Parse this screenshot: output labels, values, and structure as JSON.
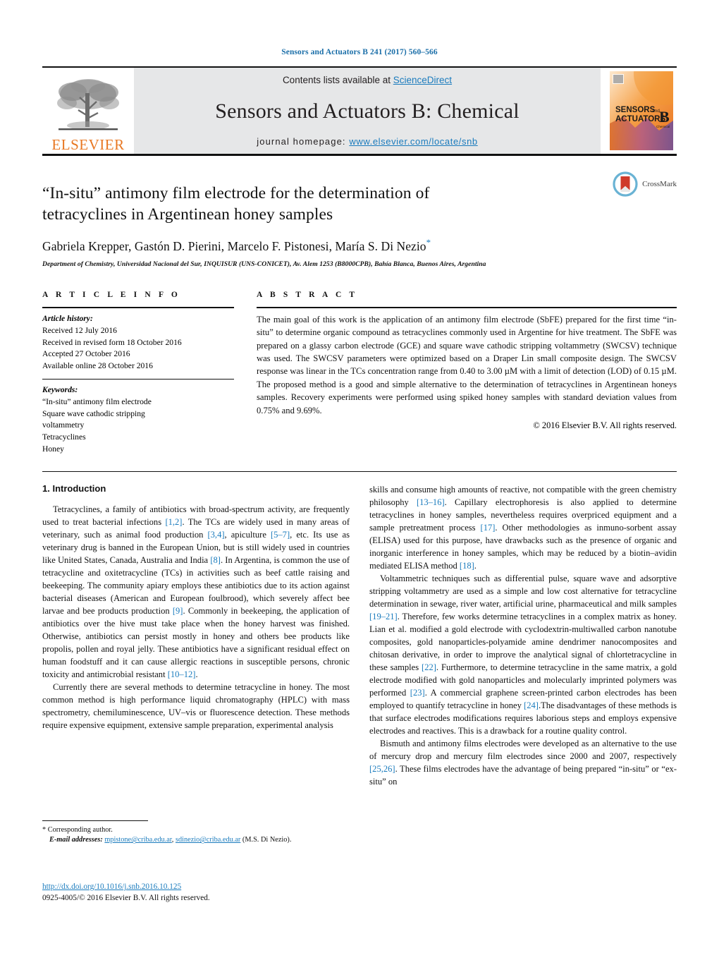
{
  "running_head": "Sensors and Actuators B 241 (2017) 560–566",
  "masthead": {
    "contents_prefix": "Contents lists available at ",
    "sciencedirect": "ScienceDirect",
    "journal_title": "Sensors and Actuators B: Chemical",
    "homepage_prefix": "journal homepage: ",
    "homepage_url": "www.elsevier.com/locate/snb",
    "publisher": "ELSEVIER",
    "cover_line1": "SENSORS",
    "cover_and": "and",
    "cover_line2": "ACTUATORS",
    "cover_letter": "B",
    "cover_sub": "Chemical",
    "accent_orange": "#E87722",
    "accent_blue": "#1a7bbd",
    "band_gray": "#e6e7e8"
  },
  "title_block": {
    "title": "“In-situ” antimony film electrode for the determination of tetracyclines in Argentinean honey samples",
    "authors": "Gabriela Krepper, Gastón D. Pierini, Marcelo F. Pistonesi, María S. Di Nezio",
    "corresponding_marker": "*",
    "affiliation": "Department of Chemistry, Universidad Nacional del Sur, INQUISUR (UNS-CONICET), Av. Alem 1253 (B8000CPB), Bahía Blanca, Buenos Aires, Argentina",
    "crossmark_label": "CrossMark"
  },
  "article_info": {
    "heading": "A R T I C L E   I N F O",
    "history_label": "Article history:",
    "history": [
      "Received 12 July 2016",
      "Received in revised form 18 October 2016",
      "Accepted 27 October 2016",
      "Available online 28 October 2016"
    ],
    "keywords_label": "Keywords:",
    "keywords": [
      "“In-situ” antimony film electrode",
      "Square wave cathodic stripping",
      "voltammetry",
      "Tetracyclines",
      "Honey"
    ]
  },
  "abstract": {
    "heading": "A B S T R A C T",
    "text": "The main goal of this work is the application of an antimony film electrode (SbFE) prepared for the first time “in-situ” to determine organic compound as tetracyclines commonly used in Argentine for hive treatment. The SbFE was prepared on a glassy carbon electrode (GCE) and square wave cathodic stripping voltammetry (SWCSV) technique was used. The SWCSV parameters were optimized based on a Draper Lin small composite design. The SWCSV response was linear in the TCs concentration range from 0.40 to 3.00 µM with a limit of detection (LOD) of 0.15 µM. The proposed method is a good and simple alternative to the determination of tetracyclines in Argentinean honeys samples. Recovery experiments were performed using spiked honey samples with standard deviation values from 0.75% and 9.69%.",
    "copyright": "© 2016 Elsevier B.V. All rights reserved."
  },
  "body": {
    "section_number_title": "1.  Introduction",
    "left_paragraphs": [
      "Tetracyclines, a family of antibiotics with broad-spectrum activity, are frequently used to treat bacterial infections [1,2]. The TCs are widely used in many areas of veterinary, such as animal food production [3,4], apiculture [5–7], etc. Its use as veterinary drug is banned in the European Union, but is still widely used in countries like United States, Canada, Australia and India [8]. In Argentina, is common the use of tetracycline and oxitetracycline (TCs) in activities such as beef cattle raising and beekeeping. The community apiary employs these antibiotics due to its action against bacterial diseases (American and European foulbrood), which severely affect bee larvae and bee products production [9]. Commonly in beekeeping, the application of antibiotics over the hive must take place when the honey harvest was finished. Otherwise, antibiotics can persist mostly in honey and others bee products like propolis, pollen and royal jelly. These antibiotics have a significant residual effect on human foodstuff and it can cause allergic reactions in susceptible persons, chronic toxicity and antimicrobial resistant [10–12].",
      "Currently there are several methods to determine tetracycline in honey. The most common method is high performance liquid chromatography (HPLC) with mass spectrometry, chemiluminescence, UV–vis or fluorescence detection. These methods require expensive equipment, extensive sample preparation, experimental analysis"
    ],
    "right_paragraphs": [
      "skills and consume high amounts of reactive, not compatible with the green chemistry philosophy [13–16]. Capillary electrophoresis is also applied to determine tetracyclines in honey samples, nevertheless requires overpriced equipment and a sample pretreatment process [17]. Other methodologies as inmuno-sorbent assay (ELISA) used for this purpose, have drawbacks such as the presence of organic and inorganic interference in honey samples, which may be reduced by a biotin–avidin mediated ELISA method [18].",
      "Voltammetric techniques such as differential pulse, square wave and adsorptive stripping voltammetry are used as a simple and low cost alternative for tetracycline determination in sewage, river water, artificial urine, pharmaceutical and milk samples [19–21]. Therefore, few works determine tetracyclines in a complex matrix as honey. Lian et al. modified a gold electrode with cyclodextrin-multiwalled carbon nanotube composites, gold nanoparticles-polyamide amine dendrimer nanocomposites and chitosan derivative, in order to improve the analytical signal of chlortetracycline in these samples [22]. Furthermore, to determine tetracycline in the same matrix, a gold electrode modified with gold nanoparticles and molecularly imprinted polymers was performed [23]. A commercial graphene screen-printed carbon electrodes has been employed to quantify tetracycline in honey [24].The disadvantages of these methods is that surface electrodes modifications requires laborious steps and employs expensive electrodes and reactives. This is a drawback for a routine quality control.",
      "Bismuth and antimony films electrodes were developed as an alternative to the use of mercury drop and mercury film electrodes since 2000 and 2007, respectively [25,26]. These films electrodes have the advantage of being prepared “in-situ” or “ex-situ” on"
    ]
  },
  "footnote": {
    "corresponding_marker": "*",
    "corresponding_label": "Corresponding author.",
    "email_label": "E-mail addresses:",
    "email1": "mpistone@criba.edu.ar",
    "email_sep": ", ",
    "email2": "sdinezio@criba.edu.ar",
    "email_attribution": " (M.S. Di Nezio).",
    "doi": "http://dx.doi.org/10.1016/j.snb.2016.10.125",
    "issn_line": "0925-4005/© 2016 Elsevier B.V. All rights reserved."
  }
}
